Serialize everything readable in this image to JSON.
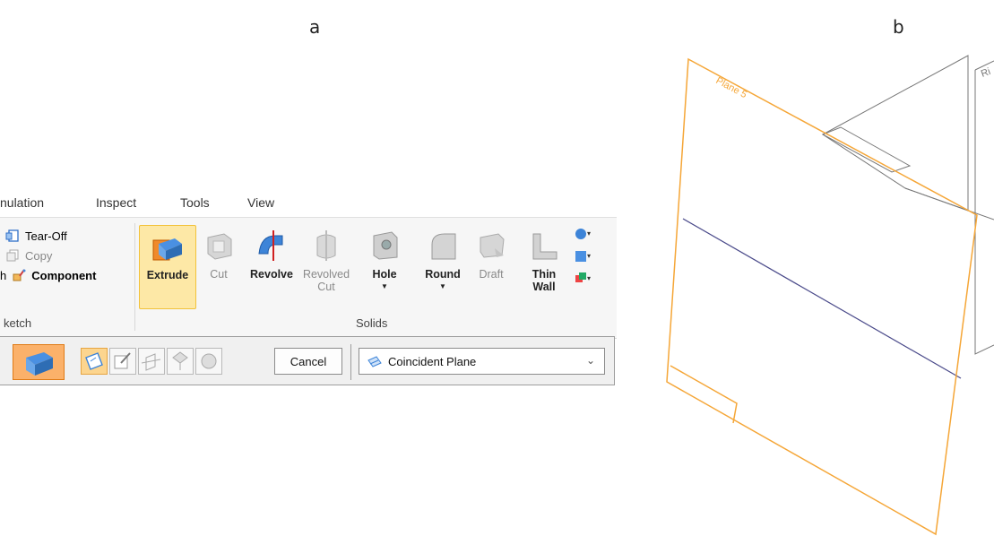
{
  "labels": {
    "a": "a",
    "b": "b"
  },
  "ribbon": {
    "tabs": [
      "nulation",
      "Inspect",
      "Tools",
      "View"
    ],
    "sketch_group": {
      "items": [
        "Tear-Off",
        "Copy",
        "Component"
      ],
      "item_left_glyphs": [
        "",
        "",
        "h"
      ],
      "label": "ketch"
    },
    "solids_group": {
      "label": "Solids",
      "tools": [
        {
          "label": "Extrude",
          "state": "active"
        },
        {
          "label": "Cut",
          "state": "disabled"
        },
        {
          "label": "Revolve",
          "state": "enabled"
        },
        {
          "label": "Revolved Cut",
          "state": "disabled"
        },
        {
          "label": "Hole",
          "state": "enabled",
          "dropdown": true
        },
        {
          "label": "Round",
          "state": "enabled",
          "dropdown": true
        },
        {
          "label": "Draft",
          "state": "disabled"
        },
        {
          "label": "Thin Wall",
          "state": "enabled",
          "dropdown": true
        }
      ]
    }
  },
  "commandbar": {
    "cancel_label": "Cancel",
    "plane_dropdown": {
      "selected": "Coincident Plane"
    }
  },
  "scene": {
    "plane_label": "Plane 5",
    "right_plane_partial_label": "Ri",
    "plane_color": "#f5a637",
    "axis_color": "#4a4a8a"
  },
  "colors": {
    "accent_orange": "#fbb16a",
    "active_tool_bg": "#fde8a6"
  }
}
